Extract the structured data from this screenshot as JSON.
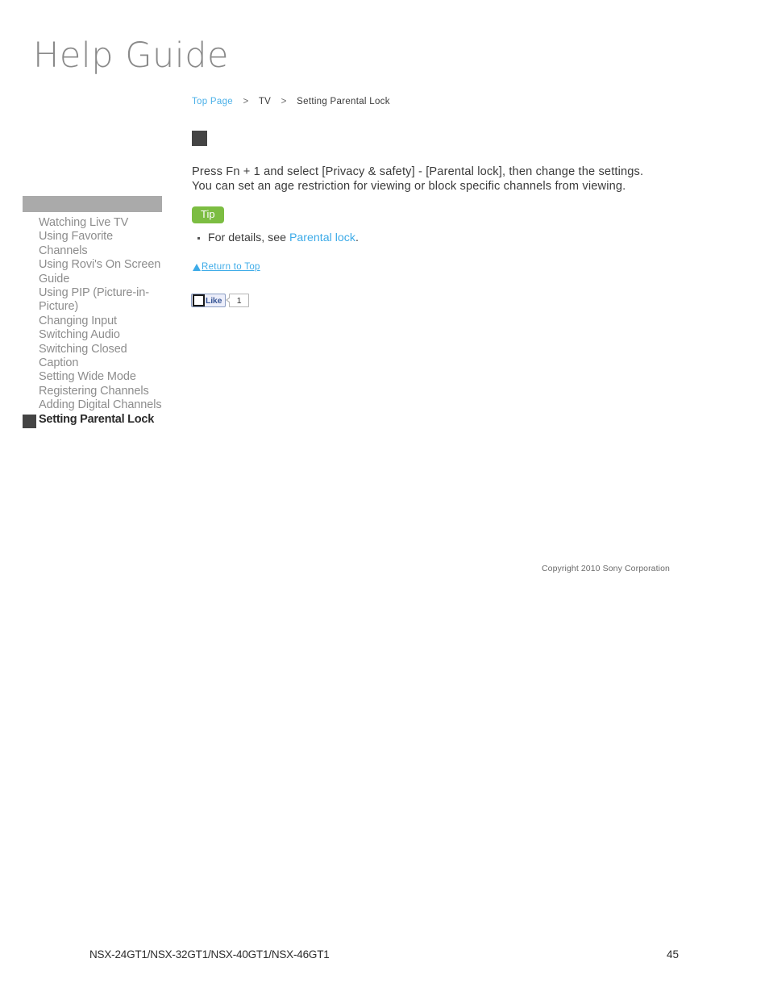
{
  "brand": {
    "logo_text": "Help Guide"
  },
  "sidebar": {
    "header_bar_label": "",
    "items": [
      {
        "label": "Watching Live TV",
        "active": false
      },
      {
        "label": "Using Favorite Channels",
        "active": false
      },
      {
        "label": "Using Rovi's On Screen Guide",
        "active": false
      },
      {
        "label": "Using PIP (Picture-in-Picture)",
        "active": false
      },
      {
        "label": "Changing Input",
        "active": false
      },
      {
        "label": "Switching Audio",
        "active": false
      },
      {
        "label": "Switching Closed Caption",
        "active": false
      },
      {
        "label": "Setting Wide Mode",
        "active": false
      },
      {
        "label": "Registering Channels",
        "active": false
      },
      {
        "label": "Adding Digital Channels",
        "active": false
      },
      {
        "label": "Setting Parental Lock",
        "active": true
      }
    ]
  },
  "breadcrumb": {
    "home_label": "Top Page",
    "separator": ">",
    "section_label": "TV",
    "current_label": "Setting Parental Lock"
  },
  "main": {
    "title_image_alt": "",
    "paragraph_line_1": "Press Fn + 1 and select [Privacy & safety] - [Parental lock], then change the settings.",
    "paragraph_line_2": "You can set an age restriction for viewing or block specific channels from viewing.",
    "tip": {
      "badge_label": "Tip",
      "item_prefix": "For details, see ",
      "item_link_label": "Parental lock",
      "item_suffix": "."
    },
    "return_to_top_label": "Return to Top"
  },
  "social": {
    "like_label": "Like",
    "like_count": "1"
  },
  "footer": {
    "copyright": "Copyright 2010 Sony Corporation",
    "models": "NSX-24GT1/NSX-32GT1/NSX-40GT1/NSX-46GT1",
    "page_number": "45"
  },
  "colors": {
    "link_blue": "#3dabe8",
    "breadcrumb_blue": "#4ab0e8",
    "tip_green": "#7cbd42",
    "sidebar_gray": "#8d8d8d",
    "sidebar_bar_gray": "#aaaaaa",
    "marker_dark": "#444444",
    "facebook_blue": "#3b5998"
  }
}
